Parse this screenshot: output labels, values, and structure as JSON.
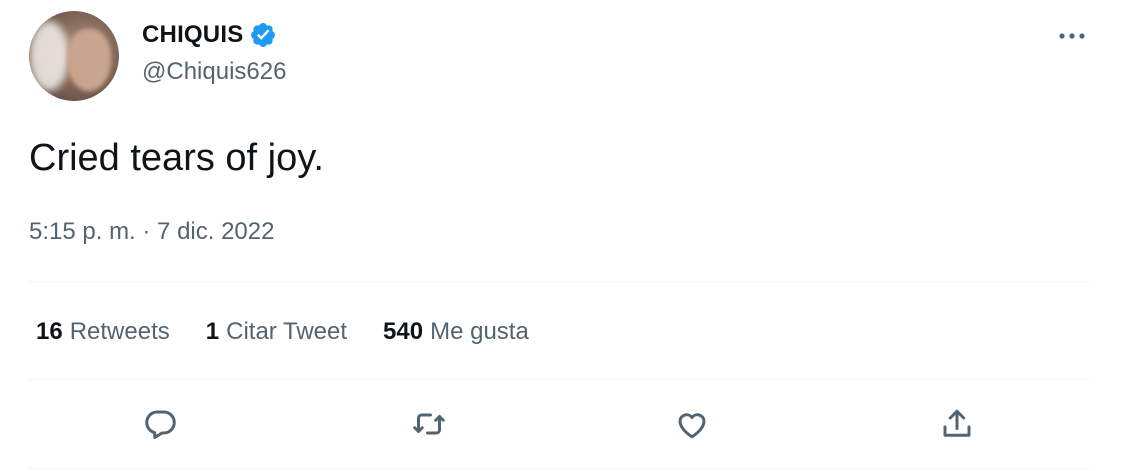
{
  "author": {
    "display_name": "CHIQUIS",
    "handle": "@Chiquis626",
    "verified": true,
    "avatar_icon": "avatar-photo"
  },
  "tweet": {
    "text": "Cried tears of joy.",
    "timestamp": "5:15 p. m. · 7 dic. 2022"
  },
  "stats": {
    "retweets": {
      "count": "16",
      "label": "Retweets"
    },
    "quotes": {
      "count": "1",
      "label": "Citar Tweet"
    },
    "likes": {
      "count": "540",
      "label": "Me gusta"
    }
  },
  "actions": {
    "reply_icon": "reply-icon",
    "retweet_icon": "retweet-icon",
    "like_icon": "heart-icon",
    "share_icon": "share-icon"
  },
  "colors": {
    "text_primary": "#0f1419",
    "text_secondary": "#536471",
    "verified_blue": "#1d9bf0",
    "divider": "#eff3f4"
  }
}
